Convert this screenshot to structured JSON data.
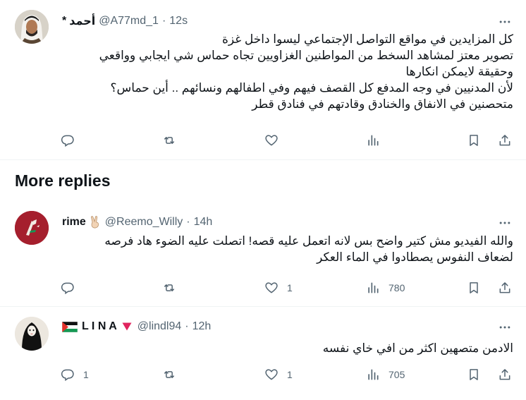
{
  "tweets": [
    {
      "name": "أحمد",
      "name_prefix": "*",
      "handle": "@A77md_1",
      "time": "12s",
      "lines": [
        "كل المزايدين في مواقع التواصل الإجتماعي ليسوا داخل غزة",
        "تصوير معتز لمشاهد السخط من المواطنين الغزاويين تجاه حماس شي ايجابي وواقعي",
        "وحقيقة لايمكن انكارها",
        "لأن المدنيين في وجه المدفع كل القصف فيهم وفي اطفالهم ونسائهم .. أين حماس؟",
        "متحصنين في الانفاق والخنادق وقادتهم في فنادق قطر"
      ],
      "replies": "",
      "reposts": "",
      "likes": "",
      "views": ""
    },
    {
      "name": "rime",
      "badge_emoji": "✌🏻",
      "handle": "@Reemo_Willy",
      "time": "14h",
      "lines": [
        "والله الفيديو مش كتير واضح بس لانه اتعمل عليه قصه! اتصلت عليه الضوء هاد فرصه",
        "لضعاف النفوس يصطادوا في الماء العكر"
      ],
      "replies": "",
      "reposts": "",
      "likes": "1",
      "views": "780"
    },
    {
      "name": "L I N A",
      "badge_emoji": "🔻",
      "handle": "@lindl94",
      "time": "12h",
      "lines": [
        "الادمن متصهين اكثر من افي خاي نفسه"
      ],
      "replies": "1",
      "reposts": "",
      "likes": "1",
      "views": "705"
    }
  ],
  "section_title": "More replies",
  "icons": {
    "reply": "reply-icon",
    "repost": "repost-icon",
    "like": "heart-icon",
    "views": "views-icon",
    "bookmark": "bookmark-icon",
    "share": "share-icon",
    "more": "more-icon"
  },
  "colors": {
    "text": "#0f1419",
    "secondary": "#536471",
    "divider": "#eff3f4",
    "avatar_rime": "#a51f2d",
    "palestine_red": "#e4312b",
    "palestine_green": "#149954"
  }
}
